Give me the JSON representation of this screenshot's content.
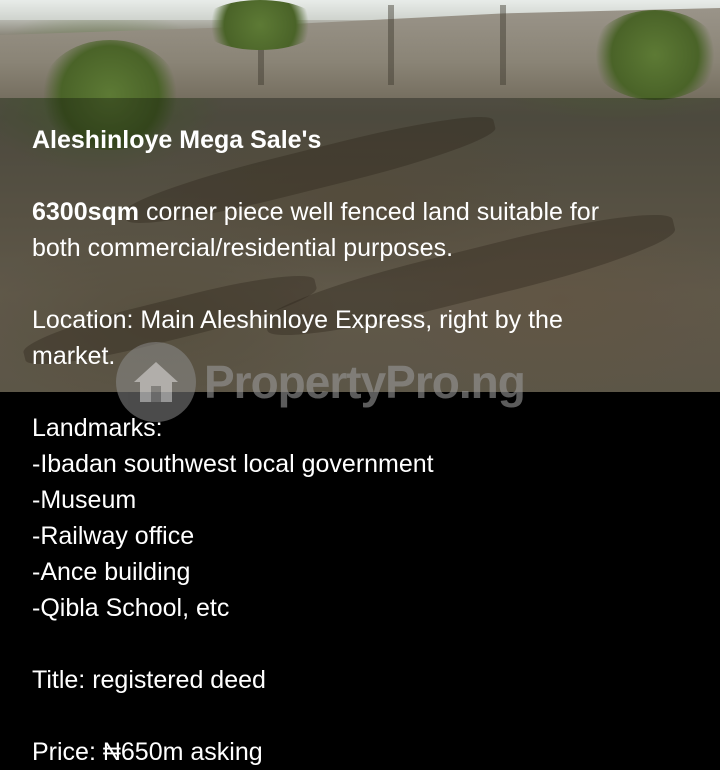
{
  "listing": {
    "heading": "Aleshinloye Mega Sale's",
    "size_highlight": "6300sqm",
    "description_rest": " corner piece well fenced land suitable for",
    "description_line2": "both commercial/residential purposes.",
    "location_line1": "Location: Main Aleshinloye Express, right by the",
    "location_line2": "market.",
    "landmarks_label": "Landmarks:",
    "landmarks": [
      "-Ibadan southwest local government",
      "-Museum",
      "-Railway office",
      "-Ance building",
      "-Qibla School, etc"
    ],
    "title_line": "Title: registered deed",
    "price_line": "Price: ₦650m asking"
  },
  "watermark": {
    "text": "PropertyPro.ng",
    "icon": "house-logo-icon"
  }
}
